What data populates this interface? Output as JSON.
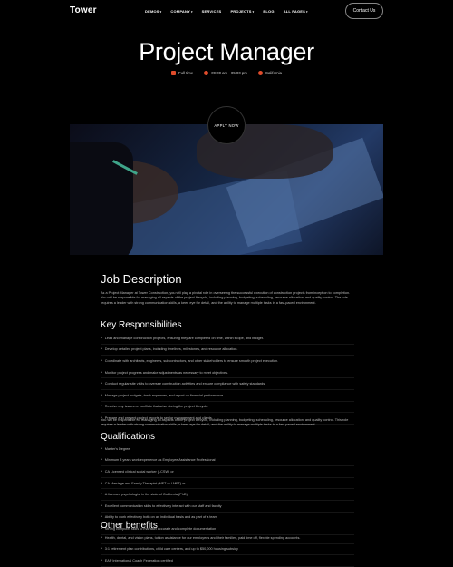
{
  "header": {
    "logo": "Tower",
    "nav": [
      {
        "label": "DEMOS",
        "caret": "▾"
      },
      {
        "label": "COMPANY",
        "caret": "▾"
      },
      {
        "label": "SERVICES",
        "caret": ""
      },
      {
        "label": "PROJECTS",
        "caret": "▾"
      },
      {
        "label": "BLOG",
        "caret": ""
      },
      {
        "label": "ALL PAGES",
        "caret": "▾"
      }
    ],
    "contact_label": "Contact Us"
  },
  "hero": {
    "title": "Project Manager",
    "meta": [
      {
        "icon": "briefcase-icon",
        "text": "Full time"
      },
      {
        "icon": "clock-icon",
        "text": "09:00 am - 05:00 pm"
      },
      {
        "icon": "location-pin-icon",
        "text": "California"
      }
    ],
    "apply_label": "APPLY NOW"
  },
  "job": {
    "heading": "Job Description",
    "intro": "As a Project Manager at Tower Construction, you will play a pivotal role in overseeing the successful execution of construction projects from inception to completion. You will be responsible for managing all aspects of the project lifecycle, including planning, budgeting, scheduling, resource allocation, and quality control. The role requires a leader with strong communication skills, a keen eye for detail, and the ability to manage multiple tasks in a fast-paced environment."
  },
  "responsibilities": {
    "heading": "Key Responsibilities",
    "items": [
      "Lead and manage construction projects, ensuring they are completed on time, within scope, and budget.",
      "Develop detailed project plans, including timelines, milestones, and resource allocation.",
      "Coordinate with architects, engineers, subcontractors, and other stakeholders to ensure smooth project execution.",
      "Monitor project progress and make adjustments as necessary to meet objectives.",
      "Conduct regular site visits to oversee construction activities and ensure compliance with safety standards.",
      "Manage project budgets, track expenses, and report on financial performance.",
      "Resolve any issues or conflicts that arise during the project lifecycle.",
      "Prepare and present project reports to senior management and clients."
    ],
    "closing": "You will be responsible for managing all aspects of the project lifecycle, including planning, budgeting, scheduling, resource allocation, and quality control. This role requires a leader with strong communication skills, a keen eye for detail, and the ability to manage multiple tasks in a fast-paced environment."
  },
  "qualifications": {
    "heading": "Qualifications",
    "items": [
      "Master's Degree",
      "Minimum 8 years work experience as Employee Assistance Professional",
      "CA Licensed clinical social worker (LCSW) or",
      "CA Marriage and Family Therapist (MFT or LMFT) or",
      "A licensed psychologist in the state of California (PhD)",
      "Excellent communication skills to effectively interact with our staff and faculty",
      "Ability to work effectively both on an individual basis and as part of a team",
      "Strong computer skills to maintain accurate and complete documentation"
    ]
  },
  "benefits": {
    "heading": "Other benefits",
    "items": [
      "Health, dental, and vision plans, tuition assistance for our employees and their families, paid time off, flexible spending accounts.",
      "3:1 retirement plan contributions, child care centers, and up to $50,000 housing subsidy",
      "EAP International Coach Federation certified"
    ]
  }
}
